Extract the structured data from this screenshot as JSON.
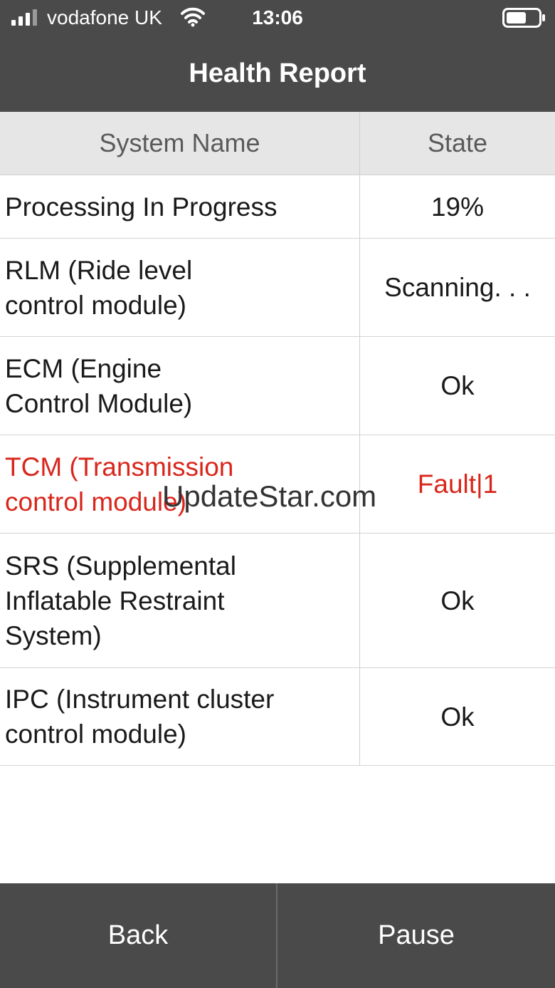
{
  "status_bar": {
    "carrier": "vodafone UK",
    "time": "13:06",
    "icons": [
      "signal-icon",
      "wifi-icon",
      "battery-icon"
    ]
  },
  "header": {
    "title": "Health Report"
  },
  "table": {
    "columns": {
      "name": "System Name",
      "state": "State"
    },
    "rows": [
      {
        "name": "Processing In Progress",
        "state": "19%"
      },
      {
        "name": "RLM (Ride level\ncontrol module)",
        "state": "Scanning. . ."
      },
      {
        "name": "ECM (Engine\nControl Module)",
        "state": "Ok"
      },
      {
        "name": "TCM (Transmission\ncontrol module)",
        "state": "Fault|1"
      },
      {
        "name": "SRS (Supplemental\nInflatable Restraint\nSystem)",
        "state": "Ok"
      },
      {
        "name": "IPC (Instrument cluster\ncontrol module)",
        "state": "Ok"
      }
    ]
  },
  "watermark": "UpdateStar.com",
  "toolbar": {
    "back_label": "Back",
    "pause_label": "Pause"
  },
  "colors": {
    "header_bg": "#4a4a4a",
    "fault": "#d9261c"
  }
}
